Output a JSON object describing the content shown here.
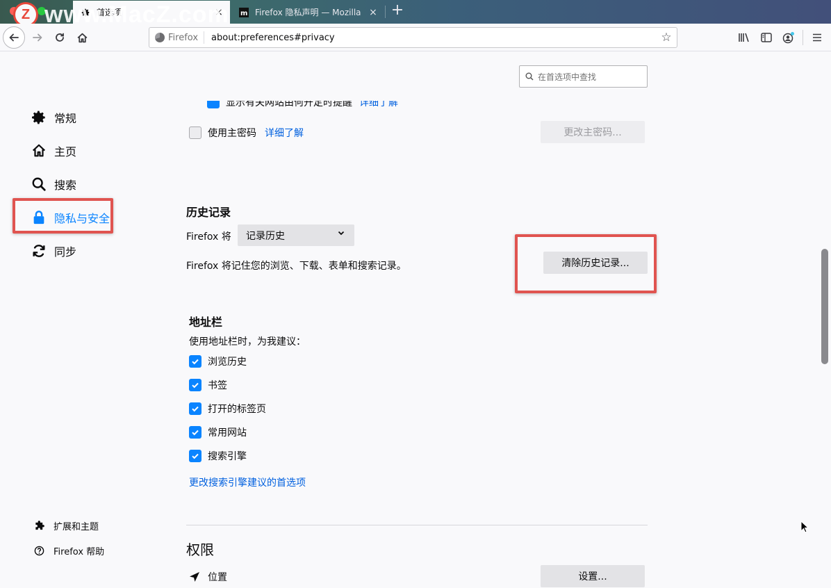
{
  "window": {
    "watermark": "www.MacZ.com",
    "watermark_logo": "Z",
    "tabs": [
      {
        "title": "首选项",
        "icon": "gear-icon",
        "active": true
      },
      {
        "title": "Firefox 隐私声明 — Mozilla",
        "icon": "mozilla-m-icon",
        "active": false
      }
    ],
    "close_glyph": "×",
    "new_tab_glyph": "+"
  },
  "toolbar": {
    "identity_label": "Firefox",
    "url": "about:preferences#privacy",
    "star_glyph": "☆"
  },
  "search": {
    "placeholder": "在首选项中查找"
  },
  "sidebar": {
    "categories": [
      {
        "label": "常规",
        "icon": "gear-icon"
      },
      {
        "label": "主页",
        "icon": "home-icon"
      },
      {
        "label": "搜索",
        "icon": "search-icon"
      },
      {
        "label": "隐私与安全",
        "icon": "lock-icon",
        "selected": true
      },
      {
        "label": "同步",
        "icon": "sync-icon"
      }
    ],
    "footer": [
      {
        "label": "扩展和主题",
        "icon": "puzzle-icon"
      },
      {
        "label": "Firefox 帮助",
        "icon": "help-icon"
      }
    ]
  },
  "logins": {
    "cutoff_row_label": "显示有关网站由何开定时提醒",
    "cutoff_row_link": "详细了解",
    "master_password_label": "使用主密码",
    "master_password_learn_more": "详细了解",
    "change_master_password": "更改主密码..."
  },
  "history": {
    "heading": "历史记录",
    "firefox_will": "Firefox 将",
    "mode_selected": "记录历史",
    "description": "Firefox 将记住您的浏览、下载、表单和搜索记录。",
    "clear_button": "清除历史记录..."
  },
  "address_bar": {
    "heading": "地址栏",
    "subtitle": "使用地址栏时，为我建议：",
    "options": [
      {
        "label": "浏览历史",
        "checked": true
      },
      {
        "label": "书签",
        "checked": true
      },
      {
        "label": "打开的标签页",
        "checked": true
      },
      {
        "label": "常用网站",
        "checked": true
      },
      {
        "label": "搜索引擎",
        "checked": true
      }
    ],
    "change_search_link": "更改搜索引擎建议的首选项"
  },
  "permissions": {
    "heading": "权限",
    "location_label": "位置",
    "settings_button": "设置..."
  },
  "colors": {
    "accent": "#0a84ff",
    "link": "#0060df",
    "highlight": "#e05450"
  }
}
